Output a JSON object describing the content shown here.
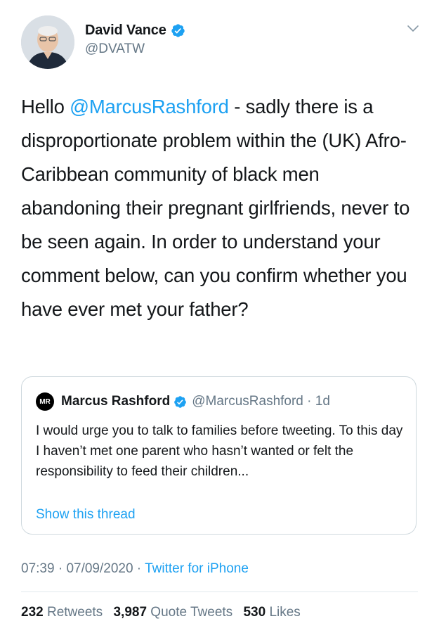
{
  "author": {
    "display_name": "David Vance",
    "handle": "@DVATW"
  },
  "tweet": {
    "text_before": "Hello ",
    "mention": "@MarcusRashford",
    "text_after": " - sadly there is a disproportionate problem within the (UK) Afro-Caribbean community of black men abandoning their pregnant girlfriends, never to be seen again. In order to understand your comment below, can you confirm whether you have ever met your father?"
  },
  "quoted_tweet": {
    "avatar_text": "MR",
    "display_name": "Marcus Rashford",
    "handle_time": "@MarcusRashford · 1d",
    "text": "I would urge you to talk to families before tweeting. To this day I haven’t met one parent who hasn’t wanted or felt the responsibility to feed their children...",
    "show_thread": "Show this thread"
  },
  "meta": {
    "time": "07:39",
    "date": "07/09/2020",
    "separator": " · ",
    "source": "Twitter for iPhone"
  },
  "stats": {
    "retweets_count": "232",
    "retweets_label": "Retweets",
    "quotes_count": "3,987",
    "quotes_label": "Quote Tweets",
    "likes_count": "530",
    "likes_label": "Likes"
  },
  "colors": {
    "accent": "#1da1f2",
    "text": "#14171a",
    "secondary": "#657786",
    "border": "#cfd9de"
  },
  "icons": {
    "verified": "verified-badge-icon",
    "caret": "chevron-down-icon"
  }
}
